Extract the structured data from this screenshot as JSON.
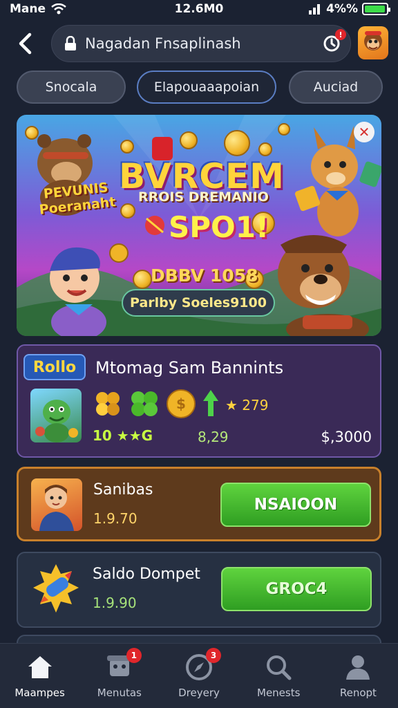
{
  "status_bar": {
    "carrier": "Mane",
    "time": "12.6M0",
    "battery_text": "4%%",
    "battery_level": 0.95
  },
  "header": {
    "search_text": "Nagadan Fnsaplinash",
    "refresh_badge": "!"
  },
  "chips": [
    {
      "label": "Snocala",
      "active": false
    },
    {
      "label": "Elapouaaapoian",
      "active": true
    },
    {
      "label": "Auciad",
      "active": false
    }
  ],
  "banner": {
    "title": "BVRCEM",
    "subtitle": "RROIS DREMANIO",
    "jackpot": "SPO1!",
    "side_text": "PEVUNIS Poeranaht",
    "prize": "DBBV 1058",
    "cta": "Parlby Soeles9100"
  },
  "promo_card": {
    "tag": "Rollo",
    "title": "Mtomag Sam Bannints",
    "score": "★ 279",
    "level": "10 ★★G",
    "price": "8,29",
    "total": "$,3000"
  },
  "offers": [
    {
      "title": "Sanibas",
      "amount": "1.9.70",
      "button": "NSAIOON"
    },
    {
      "title": "Saldo Dompet",
      "amount": "1.9.90",
      "button": "GROC4"
    }
  ],
  "bottom_nav": [
    {
      "label": "Maampes",
      "icon": "home-icon",
      "badge": "",
      "active": true
    },
    {
      "label": "Menutas",
      "icon": "robot-icon",
      "badge": "1",
      "active": false
    },
    {
      "label": "Dreyery",
      "icon": "compass-icon",
      "badge": "3",
      "active": false
    },
    {
      "label": "Menests",
      "icon": "search-icon",
      "badge": "",
      "active": false
    },
    {
      "label": "Renopt",
      "icon": "profile-icon",
      "badge": "",
      "active": false
    }
  ],
  "colors": {
    "background": "#1b2232",
    "accent_green": "#3fb52a",
    "badge_red": "#e0262b",
    "promo_purple": "#3a2a57",
    "offer_orange": "#c8802b"
  }
}
